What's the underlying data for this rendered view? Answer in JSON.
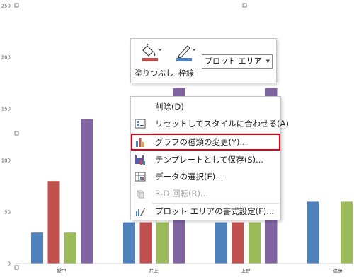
{
  "chart_data": {
    "type": "bar",
    "categories": [
      "愛甲",
      "井上",
      "上野",
      "遠藤"
    ],
    "series": [
      {
        "values": [
          30,
          40,
          40,
          60
        ],
        "color": "#4f81bd"
      },
      {
        "values": [
          80,
          40,
          40,
          0
        ],
        "color": "#c0504d"
      },
      {
        "values": [
          30,
          40,
          40,
          60
        ],
        "color": "#9bbb59"
      },
      {
        "values": [
          140,
          170,
          170,
          0
        ],
        "color": "#8064a2"
      }
    ],
    "y_ticks": [
      "0",
      "50",
      "100",
      "150",
      "200",
      "250"
    ],
    "ylim": [
      0,
      250
    ],
    "grid": false,
    "legend": "none"
  },
  "mini_toolbar": {
    "fill_label": "塗りつぶし",
    "outline_label": "枠線",
    "element_select_value": "プロット エリア"
  },
  "context_menu": {
    "items": [
      {
        "label": "削除(D)",
        "icon": "delete",
        "enabled": true,
        "highlighted": false
      },
      {
        "label": "リセットしてスタイルに合わせる(A)",
        "icon": "reset-style-icon",
        "enabled": true,
        "highlighted": false
      },
      {
        "label": "グラフの種類の変更(Y)...",
        "icon": "chart-type-icon",
        "enabled": true,
        "highlighted": true
      },
      {
        "label": "テンプレートとして保存(S)...",
        "icon": "save-template-icon",
        "enabled": true,
        "highlighted": false
      },
      {
        "label": "データの選択(E)...",
        "icon": "select-data-icon",
        "enabled": true,
        "highlighted": false
      },
      {
        "label": "3-D 回転(R)...",
        "icon": "3d-rotation-icon",
        "enabled": false,
        "highlighted": false
      },
      {
        "label": "プロット エリアの書式設定(F)...",
        "icon": "format-plot-area-icon",
        "enabled": true,
        "highlighted": false
      }
    ]
  },
  "colors": {
    "highlight_border": "#e60012",
    "fill_bucket": "#c0504d",
    "outline_pen": "#4f81bd"
  }
}
